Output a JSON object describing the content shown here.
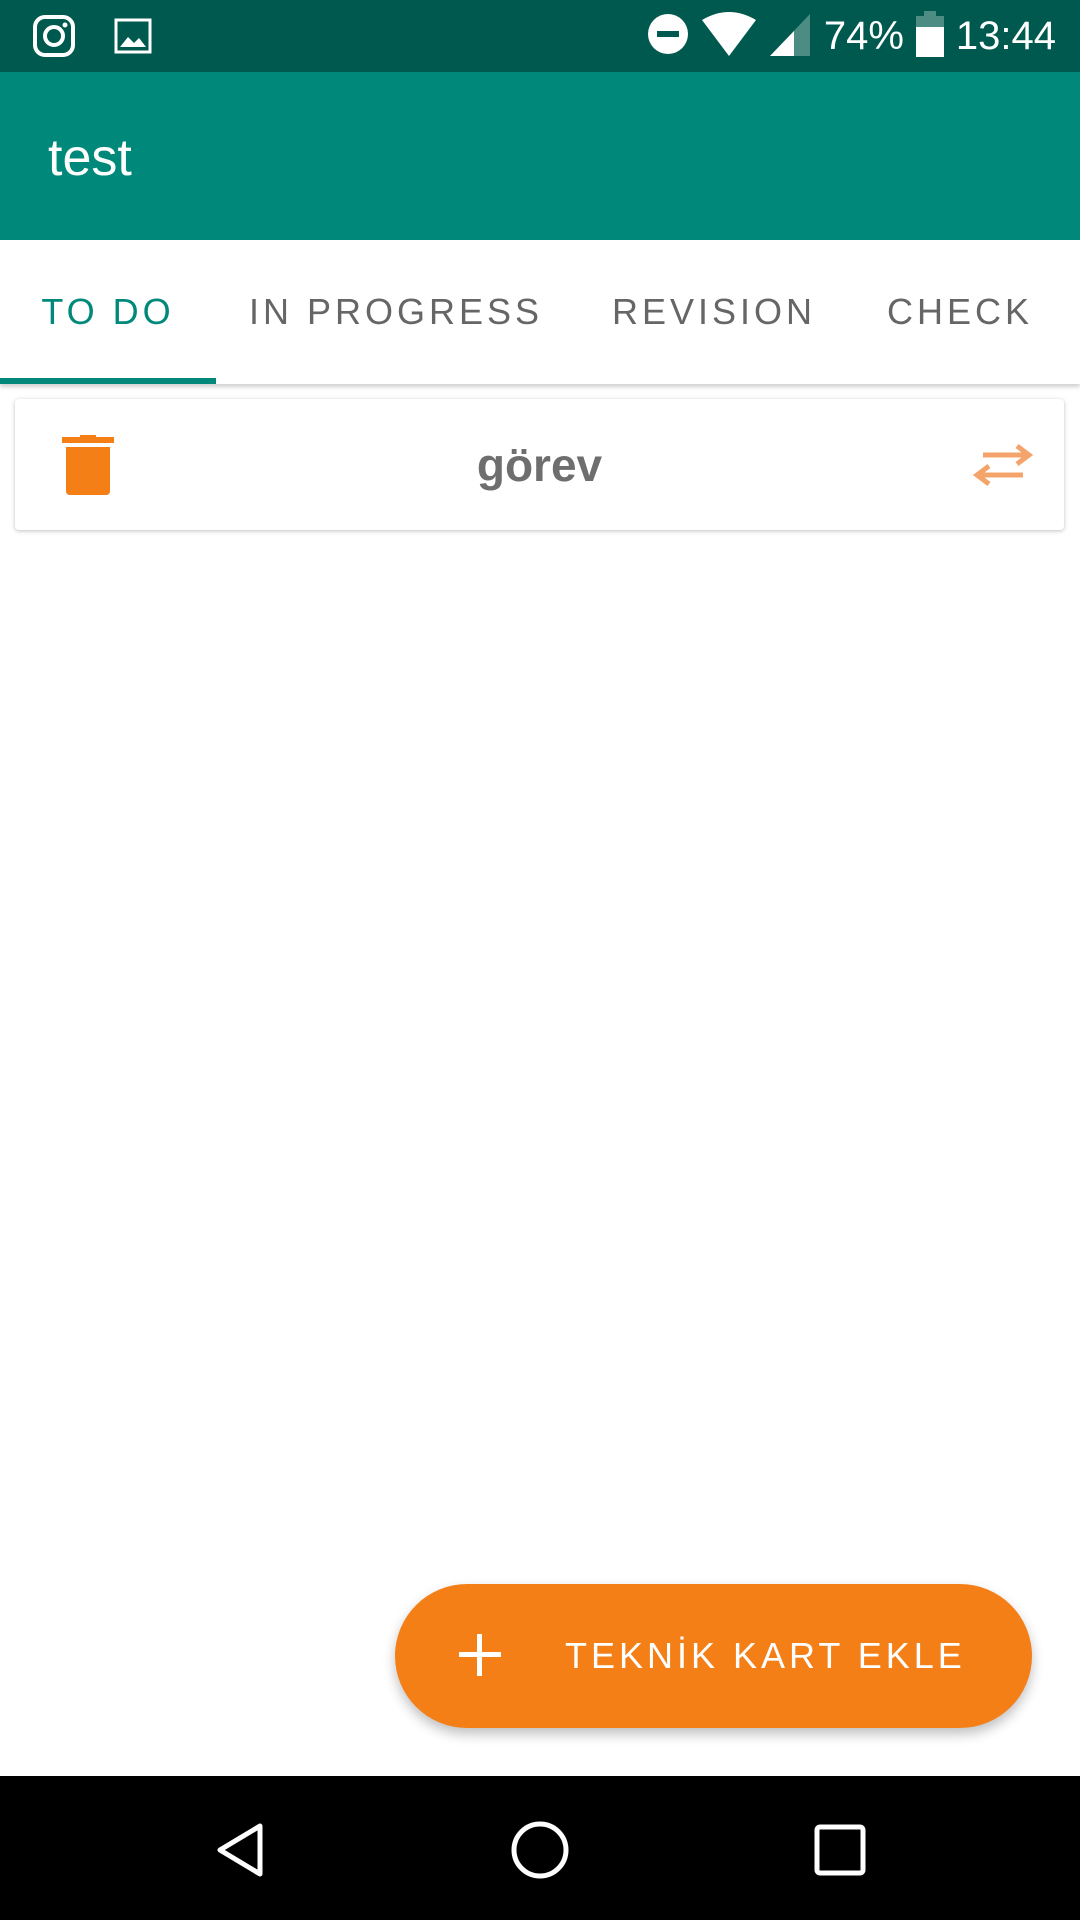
{
  "status_bar": {
    "battery_percent": "74%",
    "time": "13:44",
    "left_icons": [
      "instagram-icon",
      "gallery-icon"
    ],
    "right_icons": [
      "do-not-disturb-icon",
      "wifi-icon",
      "signal-icon",
      "battery-icon"
    ]
  },
  "app_bar": {
    "title": "test"
  },
  "tabs": [
    {
      "label": "TO DO",
      "selected": true
    },
    {
      "label": "IN PROGRESS",
      "selected": false
    },
    {
      "label": "REVISION",
      "selected": false
    },
    {
      "label": "CHECK",
      "selected": false
    }
  ],
  "cards": [
    {
      "title": "görev",
      "left_icon": "trash-icon",
      "right_icon": "swap-arrows-icon"
    }
  ],
  "fab": {
    "icon": "plus-icon",
    "label": "TEKNİK KART EKLE"
  },
  "nav_bar": {
    "buttons": [
      "back-icon",
      "home-icon",
      "recents-icon"
    ]
  },
  "colors": {
    "status_bar": "#00594f",
    "primary": "#00897b",
    "accent": "#f57f17",
    "swap_icon": "#f4a46a",
    "tab_text": "#666666",
    "card_text": "#6e6e6e"
  }
}
